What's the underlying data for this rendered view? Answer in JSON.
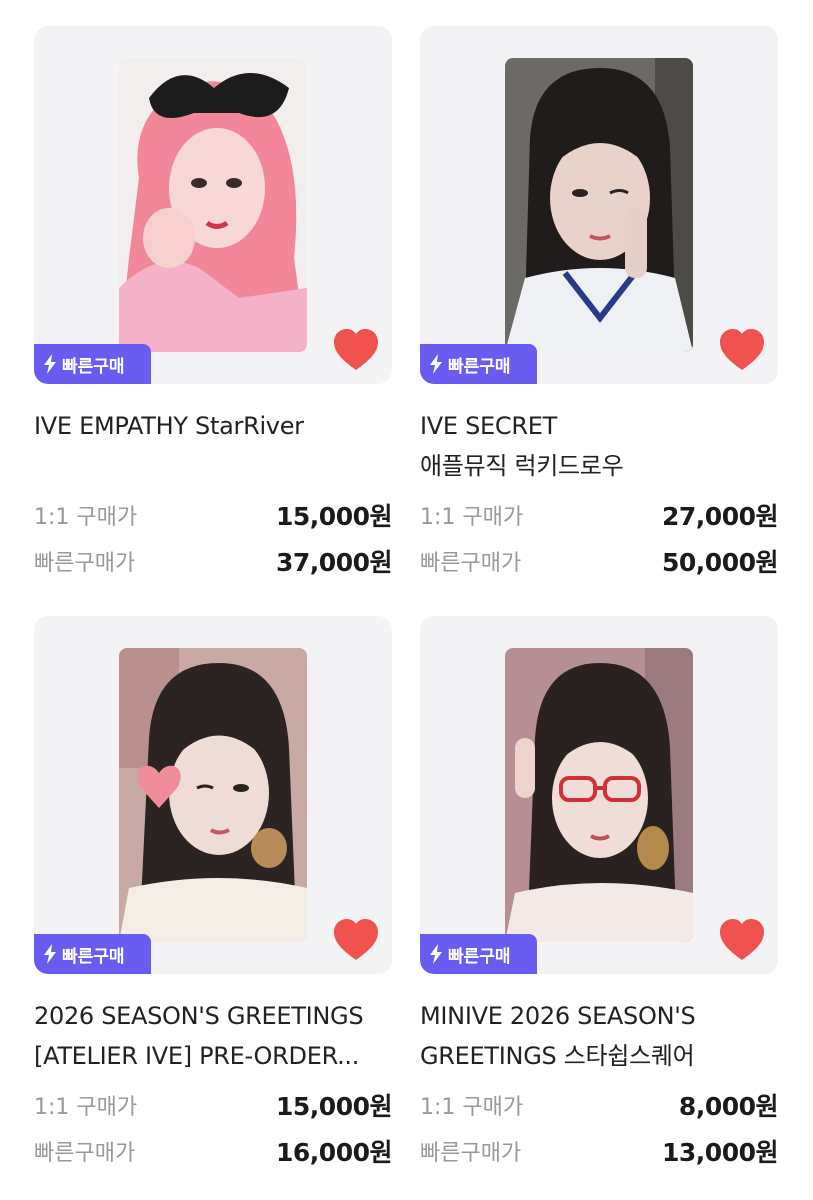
{
  "products": [
    {
      "badge": "빠른구매",
      "title_line1": "IVE EMPATHY StarRiver",
      "title_line2": "",
      "price1_label": "1:1 구매가",
      "price1_value": "15,000원",
      "price2_label": "빠른구매가",
      "price2_value": "37,000원"
    },
    {
      "badge": "빠른구매",
      "title_line1": "IVE SECRET",
      "title_line2": "애플뮤직 럭키드로우",
      "price1_label": "1:1 구매가",
      "price1_value": "27,000원",
      "price2_label": "빠른구매가",
      "price2_value": "50,000원"
    },
    {
      "badge": "빠른구매",
      "title_line1": "2026 SEASON'S GREETINGS",
      "title_line2": "[ATELIER IVE] PRE-ORDER...",
      "price1_label": "1:1 구매가",
      "price1_value": "15,000원",
      "price2_label": "빠른구매가",
      "price2_value": "16,000원"
    },
    {
      "badge": "빠른구매",
      "title_line1": "MINIVE 2026 SEASON'S",
      "title_line2": "GREETINGS 스타쉽스퀘어",
      "price1_label": "1:1 구매가",
      "price1_value": "8,000원",
      "price2_label": "빠른구매가",
      "price2_value": "13,000원"
    }
  ],
  "colors": {
    "badge_bg": "#6a5cf0",
    "heart": "#f0524f",
    "card_bg": "#f3f3f5"
  },
  "icons": {
    "badge_icon": "lightning-icon",
    "favorite_icon": "heart-icon"
  }
}
